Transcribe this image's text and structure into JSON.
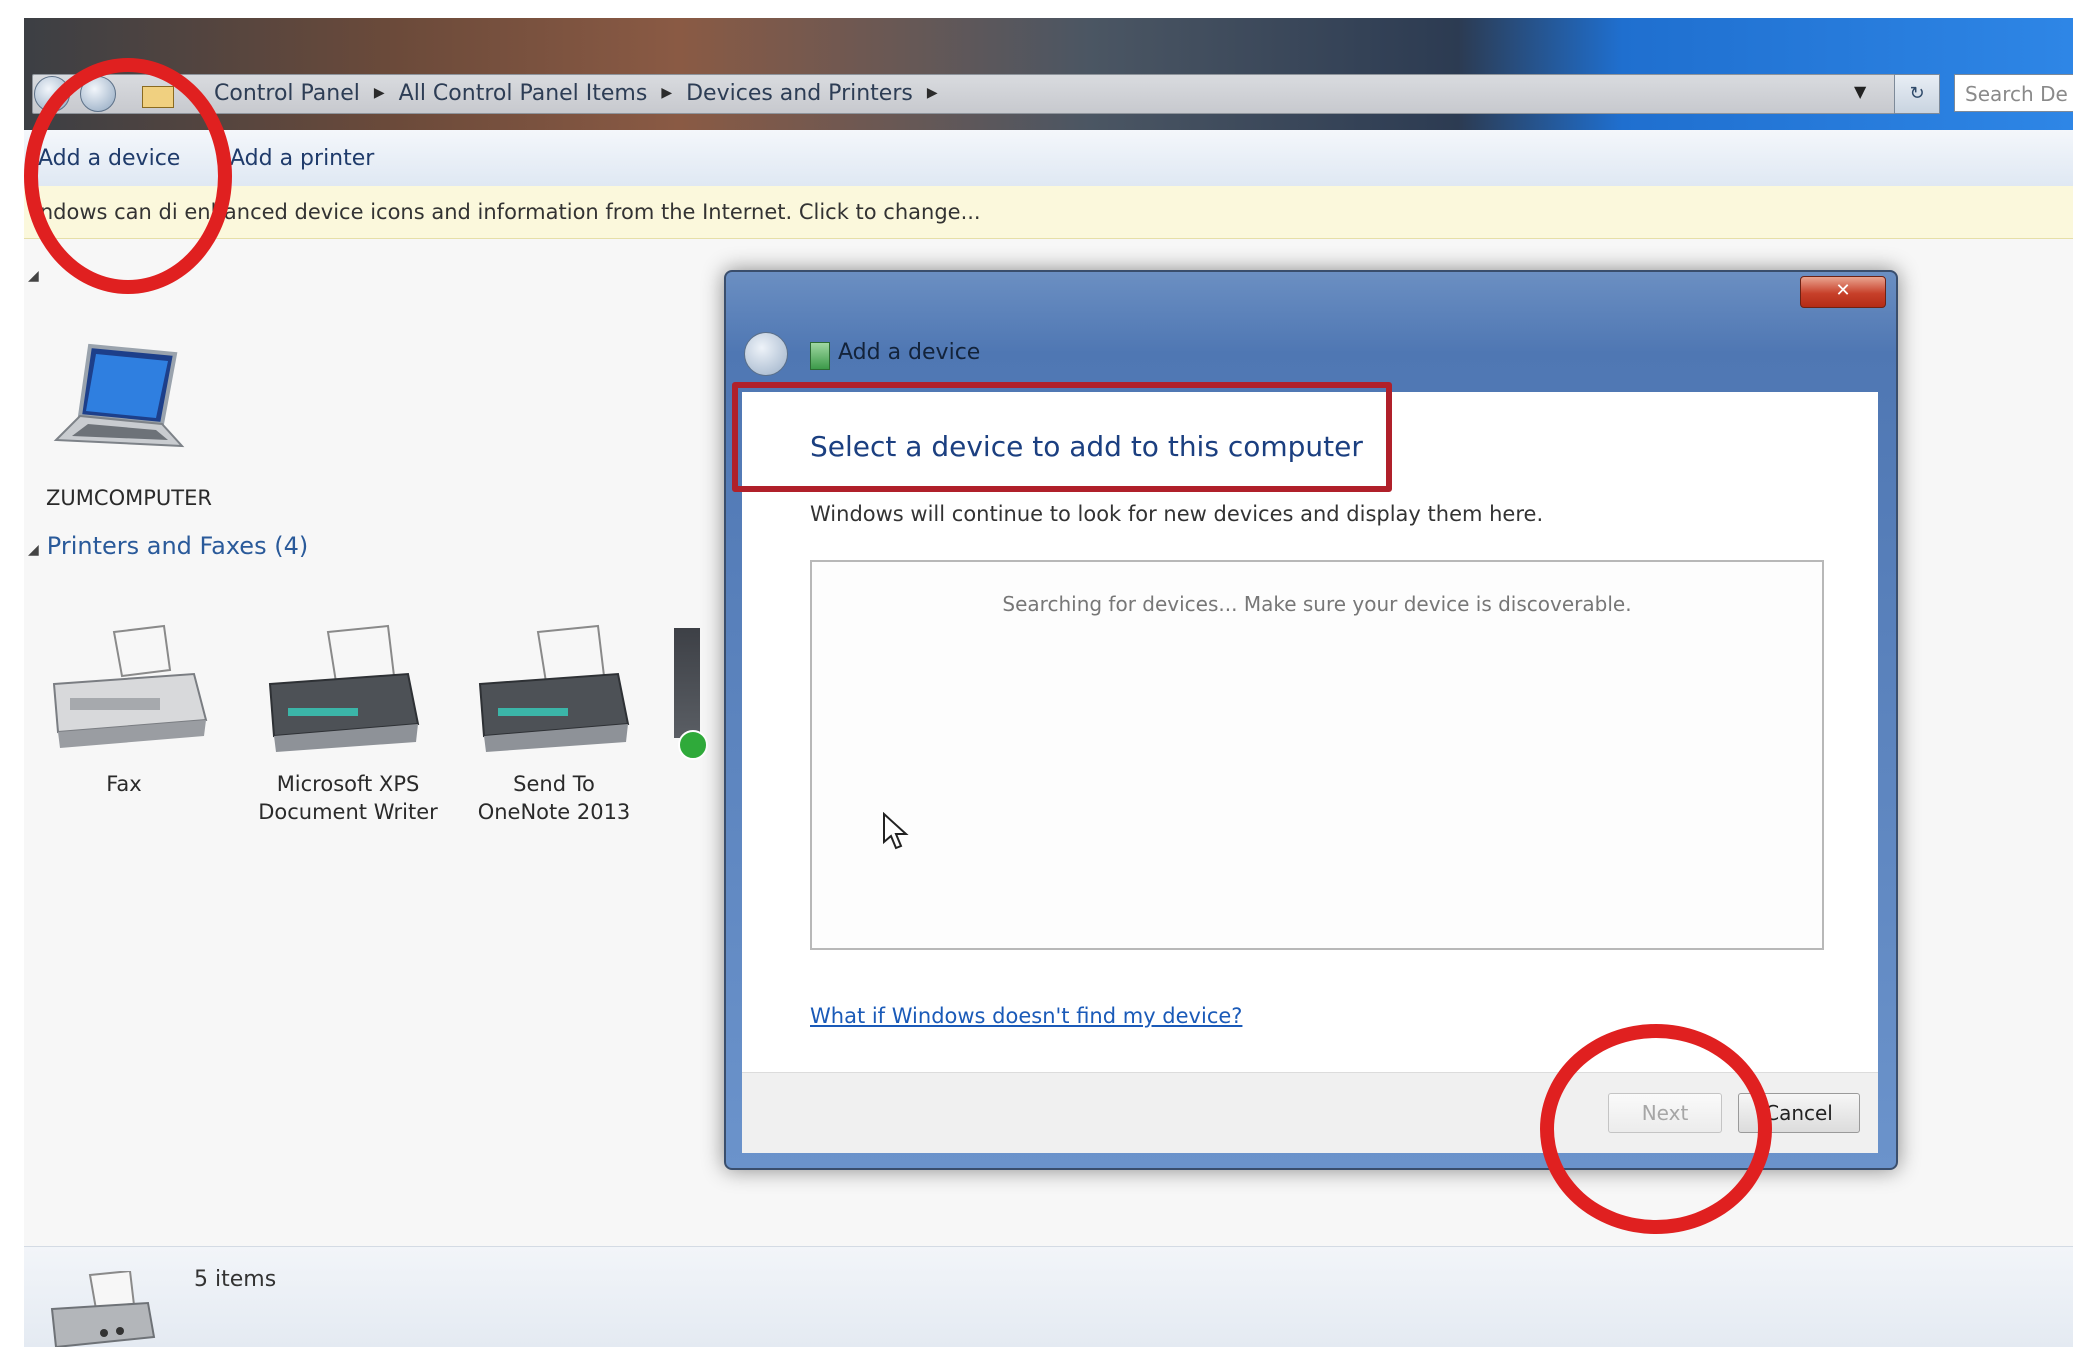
{
  "explorer": {
    "breadcrumbs": [
      "Control Panel",
      "All Control Panel Items",
      "Devices and Printers"
    ],
    "search_placeholder": "Search De",
    "commands": {
      "add_device": "Add a device",
      "add_printer": "Add a printer"
    },
    "infobar_text": "indows can di    enhanced device icons and information from the Internet. Click to change...",
    "devices_section": {
      "computer_label": "ZUMCOMPUTER"
    },
    "printers_section": {
      "heading": "Printers and Faxes (4)",
      "items": [
        {
          "label_line1": "Fax",
          "label_line2": ""
        },
        {
          "label_line1": "Microsoft XPS",
          "label_line2": "Document Writer"
        },
        {
          "label_line1": "Send To",
          "label_line2": "OneNote 2013"
        }
      ]
    },
    "status": {
      "item_count": "5 items"
    }
  },
  "dialog": {
    "title": "Add a device",
    "heading": "Select a device to add to this computer",
    "subtext": "Windows will continue to look for new devices and display them here.",
    "searching_text": "Searching for devices...  Make sure your device is discoverable.",
    "help_link": "What if Windows doesn't find my device?",
    "buttons": {
      "next": "Next",
      "cancel": "Cancel"
    }
  },
  "colors": {
    "annotation_red": "#e02020",
    "link_blue": "#1a5ab8",
    "heading_blue": "#1b3f80"
  }
}
